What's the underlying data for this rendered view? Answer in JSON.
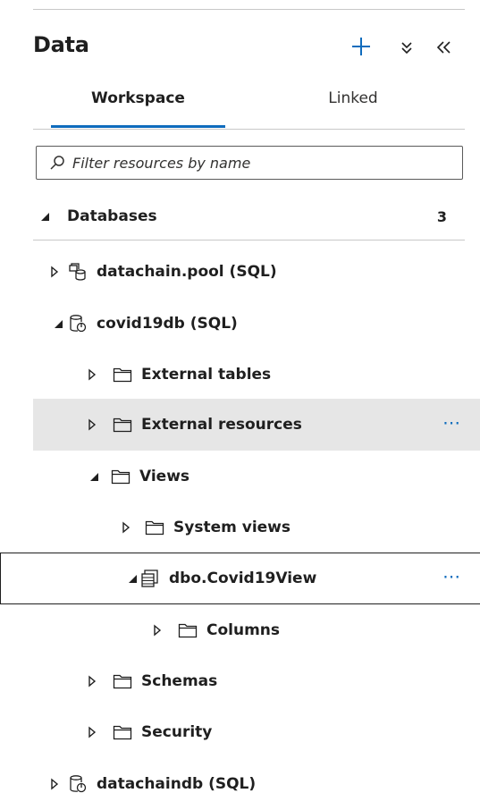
{
  "header": {
    "title": "Data"
  },
  "tabs": [
    {
      "label": "Workspace",
      "active": true
    },
    {
      "label": "Linked",
      "active": false
    }
  ],
  "filter": {
    "placeholder": "Filter resources by name",
    "value": ""
  },
  "databases": {
    "label": "Databases",
    "count": "3"
  },
  "tree": [
    {
      "label": "datachain.pool (SQL)",
      "icon": "sql-pool-icon",
      "expanded": false
    },
    {
      "label": "covid19db (SQL)",
      "icon": "database-icon",
      "expanded": true
    },
    {
      "label": "External tables",
      "icon": "folder-icon",
      "expanded": false
    },
    {
      "label": "External resources",
      "icon": "folder-icon",
      "expanded": false,
      "more": "⋯"
    },
    {
      "label": "Views",
      "icon": "folder-icon",
      "expanded": true
    },
    {
      "label": "System views",
      "icon": "folder-icon",
      "expanded": false
    },
    {
      "label": "dbo.Covid19View",
      "icon": "view-icon",
      "expanded": true,
      "more": "⋯"
    },
    {
      "label": "Columns",
      "icon": "folder-icon",
      "expanded": false
    },
    {
      "label": "Schemas",
      "icon": "folder-icon",
      "expanded": false
    },
    {
      "label": "Security",
      "icon": "folder-icon",
      "expanded": false
    },
    {
      "label": "datachaindb (SQL)",
      "icon": "database-icon",
      "expanded": false
    }
  ],
  "colors": {
    "accent": "#0f6cbd",
    "hover_row": "#e6e6e6",
    "divider": "#c8c8c8"
  }
}
